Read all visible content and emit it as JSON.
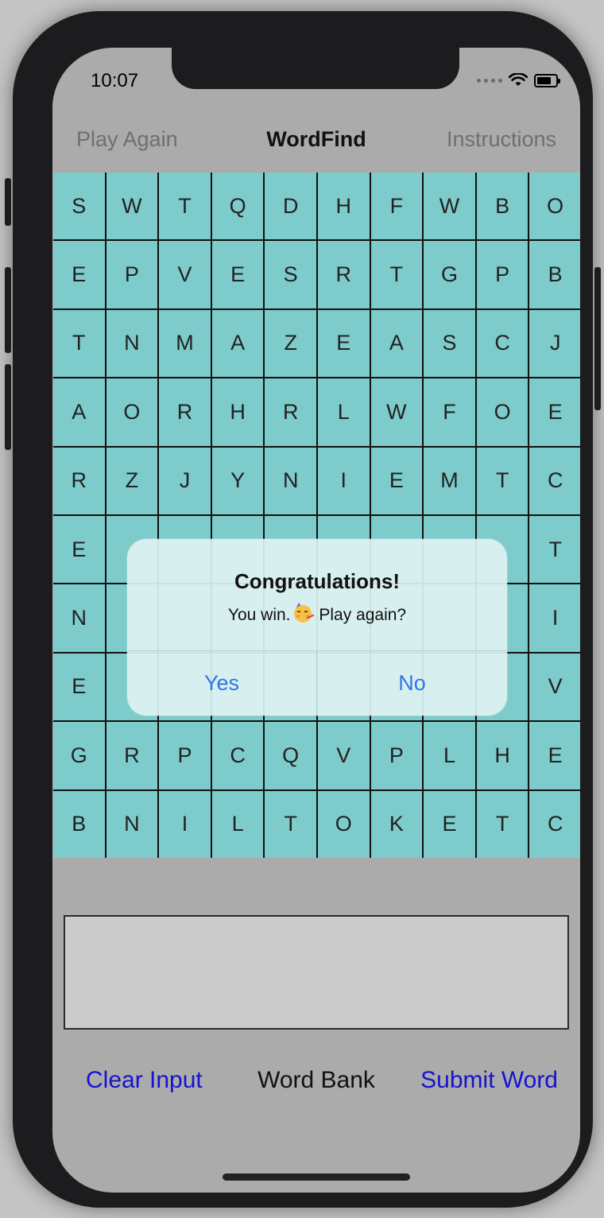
{
  "status": {
    "time": "10:07"
  },
  "nav": {
    "left": "Play Again",
    "title": "WordFind",
    "right": "Instructions"
  },
  "grid": [
    [
      "S",
      "W",
      "T",
      "Q",
      "D",
      "H",
      "F",
      "W",
      "B",
      "O"
    ],
    [
      "E",
      "P",
      "V",
      "E",
      "S",
      "R",
      "T",
      "G",
      "P",
      "B"
    ],
    [
      "T",
      "N",
      "M",
      "A",
      "Z",
      "E",
      "A",
      "S",
      "C",
      "J"
    ],
    [
      "A",
      "O",
      "R",
      "H",
      "R",
      "L",
      "W",
      "F",
      "O",
      "E"
    ],
    [
      "R",
      "Z",
      "J",
      "Y",
      "N",
      "I",
      "E",
      "M",
      "T",
      "C"
    ],
    [
      "E",
      "",
      "",
      "",
      "",
      "",
      "",
      "",
      "",
      "T"
    ],
    [
      "N",
      "",
      "",
      "",
      "",
      "",
      "",
      "",
      "",
      "I"
    ],
    [
      "E",
      "",
      "",
      "",
      "",
      "",
      "",
      "",
      "",
      "V"
    ],
    [
      "G",
      "R",
      "P",
      "C",
      "Q",
      "V",
      "P",
      "L",
      "H",
      "E"
    ],
    [
      "B",
      "N",
      "I",
      "L",
      "T",
      "O",
      "K",
      "E",
      "T",
      "C"
    ]
  ],
  "input": {
    "value": ""
  },
  "bottom": {
    "clear": "Clear Input",
    "bank": "Word Bank",
    "submit": "Submit Word"
  },
  "alert": {
    "title": "Congratulations!",
    "message_before": "You win.",
    "emoji": "partying-face",
    "message_after": " Play again?",
    "yes": "Yes",
    "no": "No"
  },
  "colors": {
    "cell": "#7ecbcb",
    "link": "#1414ce",
    "alert_button": "#2f76e8"
  }
}
